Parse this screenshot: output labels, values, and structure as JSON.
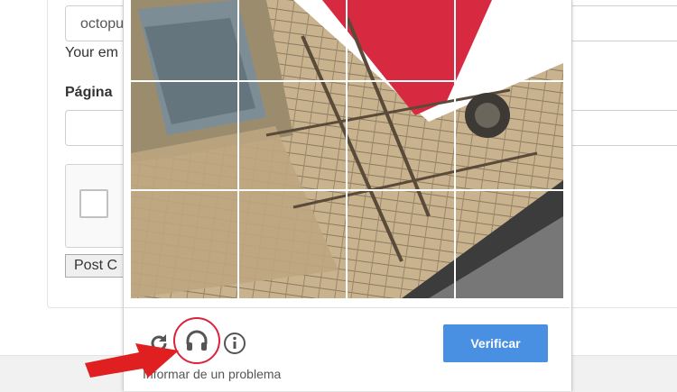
{
  "form": {
    "email_value": "octopu",
    "email_hint": "Your em",
    "page_label": "Página",
    "post_button_label": "Post C"
  },
  "captcha": {
    "report_link": "Informar de un problema",
    "verify_button_label": "Verificar",
    "grid": {
      "rows": 3,
      "cols": 4
    },
    "icons": [
      "reload-icon",
      "headphones-icon",
      "info-icon"
    ],
    "accent_color": "#4a90e2",
    "highlight_color": "#d9243d"
  }
}
